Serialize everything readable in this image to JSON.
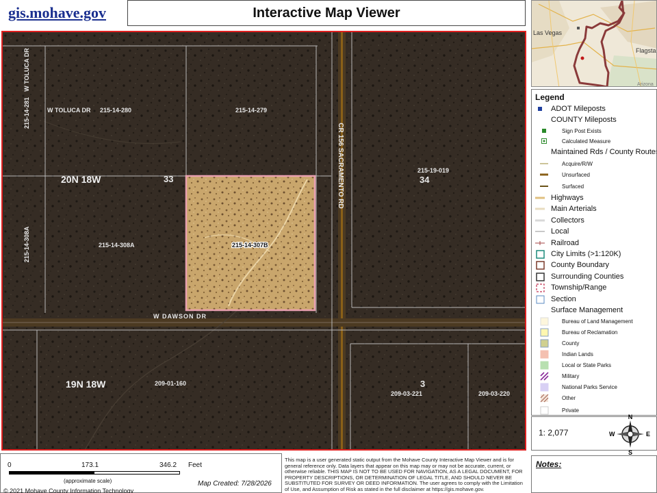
{
  "header": {
    "site_link": "gis.mohave.gov",
    "title": "Interactive Map Viewer"
  },
  "locator_map": {
    "labels": [
      "Las Vegas",
      "Flagsta",
      "Arizona"
    ]
  },
  "map": {
    "labels": {
      "w_toluca_vertical": "W TOLUCA DR",
      "w_toluca_horizontal": "W TOLUCA DR",
      "parcel_280": "215-14-280",
      "parcel_279": "215-14-279",
      "parcel_281": "215-14-281",
      "township_20n": "20N 18W",
      "section_33": "33",
      "road_sacramento": "CR 156 SACRAMENTO RD",
      "parcel_019": "215-19-019",
      "section_34": "34",
      "parcel_308a_vertical": "215-14-308A",
      "parcel_308a": "215-14-308A",
      "parcel_307b": "215-14-307B",
      "w_dawson": "W DAWSON DR",
      "township_19n": "19N 18W",
      "parcel_160": "209-01-160",
      "section_3": "3",
      "parcel_221": "209-03-221",
      "parcel_220": "209-03-220"
    },
    "colors": {
      "frame": "#e02020",
      "parcel_outline": "#b9b9b9",
      "highlight": "#e9a0b0",
      "road": "#8a6018"
    }
  },
  "legend": {
    "title": "Legend",
    "items": [
      {
        "label": "ADOT Mileposts",
        "level": "main",
        "symbol": "square-blue"
      },
      {
        "label": "COUNTY Mileposts",
        "level": "main",
        "symbol": "none"
      },
      {
        "label": "Sign Post Exists",
        "level": "sub",
        "symbol": "square-green"
      },
      {
        "label": "Calculated Measure",
        "level": "sub",
        "symbol": "square-green-dot"
      },
      {
        "label": "Maintained Rds / County Routes",
        "level": "main",
        "symbol": "none"
      },
      {
        "label": "Acquire/R/W",
        "level": "sub",
        "symbol": "line-thin-olive"
      },
      {
        "label": "Unsurfaced",
        "level": "sub",
        "symbol": "line-brown"
      },
      {
        "label": "Surfaced",
        "level": "sub",
        "symbol": "line-dark-olive"
      },
      {
        "label": "Highways",
        "level": "main",
        "symbol": "line-tan"
      },
      {
        "label": "Main Arterials",
        "level": "main",
        "symbol": "line-light-tan"
      },
      {
        "label": "Collectors",
        "level": "main",
        "symbol": "line-light-gray"
      },
      {
        "label": "Local",
        "level": "main",
        "symbol": "line-gray"
      },
      {
        "label": "Railroad",
        "level": "main",
        "symbol": "line-rail"
      },
      {
        "label": "City Limits (>1:120K)",
        "level": "main",
        "symbol": "box-teal"
      },
      {
        "label": "County Boundary",
        "level": "main",
        "symbol": "box-brown"
      },
      {
        "label": "Surrounding Counties",
        "level": "main",
        "symbol": "box-dark"
      },
      {
        "label": "Township/Range",
        "level": "main",
        "symbol": "box-dashed-red"
      },
      {
        "label": "Section",
        "level": "main",
        "symbol": "box-blue"
      },
      {
        "label": "Surface Management",
        "level": "main",
        "symbol": "none"
      },
      {
        "label": "Bureau of Land Management",
        "level": "sub",
        "symbol": "fill-cream"
      },
      {
        "label": "Bureau of Reclamation",
        "level": "sub",
        "symbol": "fill-yellow"
      },
      {
        "label": "County",
        "level": "sub",
        "symbol": "fill-gray-blue"
      },
      {
        "label": "Indian Lands",
        "level": "sub",
        "symbol": "fill-salmon"
      },
      {
        "label": "Local or State Parks",
        "level": "sub",
        "symbol": "fill-green"
      },
      {
        "label": "Military",
        "level": "sub",
        "symbol": "fill-purple-hatch"
      },
      {
        "label": "National Parks Service",
        "level": "sub",
        "symbol": "fill-lavender"
      },
      {
        "label": "Other",
        "level": "sub",
        "symbol": "fill-brown-hatch"
      },
      {
        "label": "Private",
        "level": "sub",
        "symbol": "fill-white"
      }
    ]
  },
  "scale": {
    "ratio": "1: 2,077",
    "bar_ticks": [
      "0",
      "173.1",
      "346.2"
    ],
    "units": "Feet",
    "approx_note": "(approximate scale)"
  },
  "compass": {
    "n": "N",
    "s": "S",
    "e": "E",
    "w": "W"
  },
  "footer": {
    "copyright": "© 2021 Mohave County Information Technology",
    "map_created": "Map Created: 7/28/2026",
    "disclaimer": "This map is a user generated static output from the Mohave County Interactive Map Viewer and is for general reference only. Data layers that appear on this map may or may not be accurate, current, or otherwise reliable. THIS MAP IS NOT TO BE USED FOR NAVIGATION, AS A LEGAL DOCUMENT, FOR PROPERTY DESCRIPTIONS, OR DETERMINATION OF LEGAL TITLE, AND SHOULD NEVER BE SUBSTITUTED FOR SURVEY OR DEED INFORMATION. The user agrees to comply with the Limitation of Use, and Assumption of Risk as stated in the full disclaimer at https://gis.mohave.gov.",
    "notes_label": "Notes:"
  }
}
